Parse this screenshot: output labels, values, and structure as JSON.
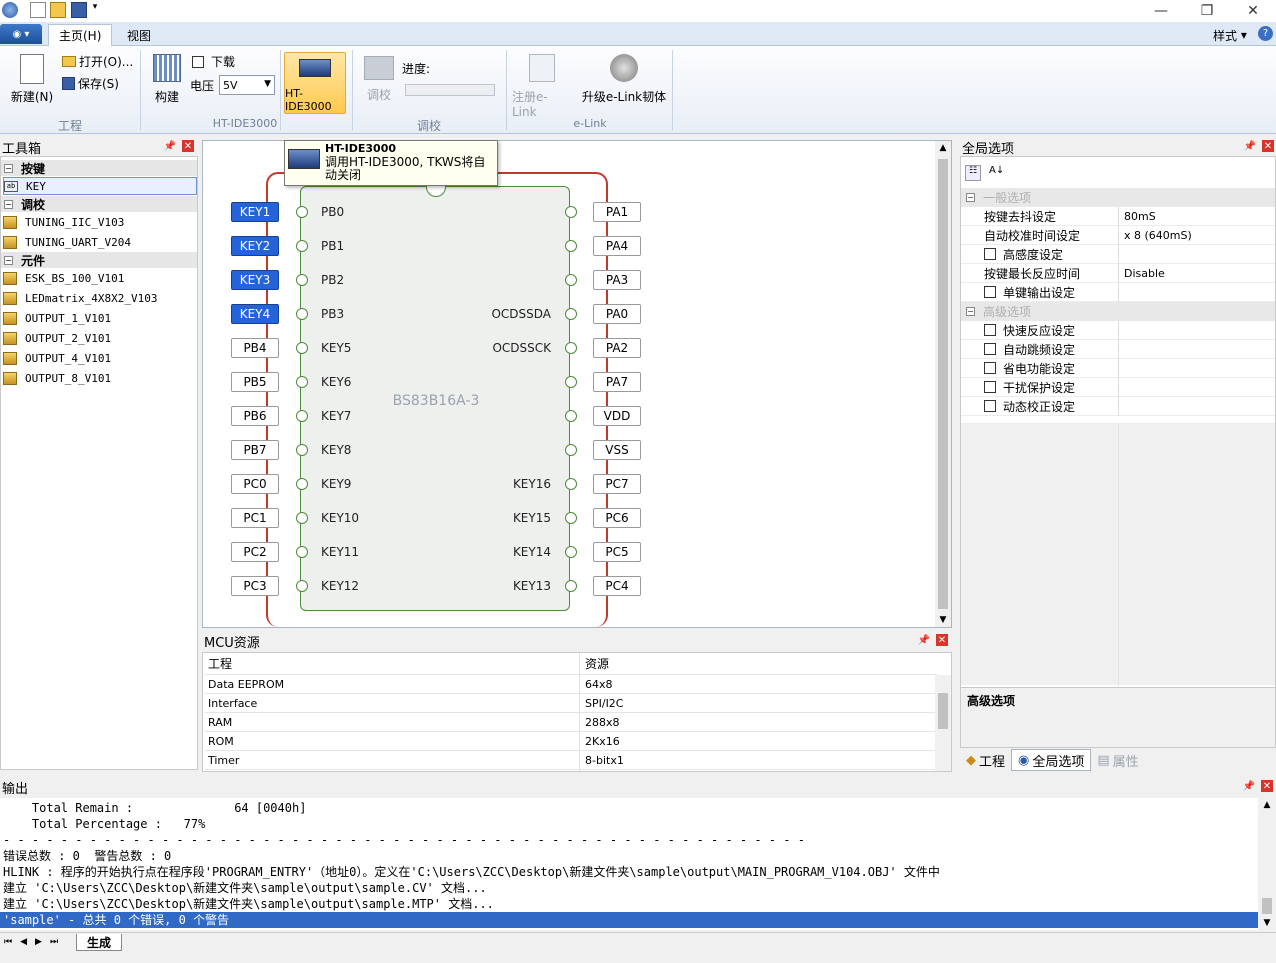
{
  "ribbon_tabs": {
    "main": "主页(H)",
    "view": "视图",
    "style": "样式"
  },
  "ribbon": {
    "new": "新建(N)",
    "open": "打开(O)...",
    "save": "保存(S)",
    "group_project": "工程",
    "build": "构建",
    "download": "下载",
    "voltage_label": "电压",
    "voltage_value": "5V",
    "ide_button": "HT-IDE3000",
    "group_ide": "HT-IDE3000",
    "calibrate": "调校",
    "progress_label": "进度:",
    "progress_value": 0,
    "group_calibrate": "调校",
    "register_elink": "注册e-Link",
    "upgrade_elink": "升级e-Link韧体",
    "group_elink": "e-Link"
  },
  "tooltip": {
    "title": "HT-IDE3000",
    "text": "调用HT-IDE3000, TKWS将自动关闭"
  },
  "toolbox": {
    "title": "工具箱",
    "categories": [
      {
        "label": "按键",
        "items": [
          "KEY"
        ]
      },
      {
        "label": "调校",
        "items": [
          "TUNING_IIC_V103",
          "TUNING_UART_V204"
        ]
      },
      {
        "label": "元件",
        "items": [
          "ESK_BS_100_V101",
          "LEDmatrix_4X8X2_V103",
          "OUTPUT_1_V101",
          "OUTPUT_2_V101",
          "OUTPUT_4_V101",
          "OUTPUT_8_V101"
        ]
      }
    ]
  },
  "designer": {
    "chip_name": "BS83B16A-3",
    "left_labels": [
      "KEY1",
      "KEY2",
      "KEY3",
      "KEY4",
      "PB4",
      "PB5",
      "PB6",
      "PB7",
      "PC0",
      "PC1",
      "PC2",
      "PC3"
    ],
    "left_pins": [
      "PB0",
      "PB1",
      "PB2",
      "PB3",
      "KEY5",
      "KEY6",
      "KEY7",
      "KEY8",
      "KEY9",
      "KEY10",
      "KEY11",
      "KEY12"
    ],
    "right_pins": [
      "",
      "",
      "",
      "OCDSSDA",
      "OCDSSCK",
      "",
      "",
      "",
      "KEY16",
      "KEY15",
      "KEY14",
      "KEY13"
    ],
    "right_labels": [
      "PA1",
      "PA4",
      "PA3",
      "PA0",
      "PA2",
      "PA7",
      "VDD",
      "VSS",
      "PC7",
      "PC6",
      "PC5",
      "PC4"
    ]
  },
  "mcu": {
    "title": "MCU资源",
    "col1": "工程",
    "col2": "资源",
    "rows": [
      [
        "Data EEPROM",
        "64x8"
      ],
      [
        "Interface",
        "SPI/I2C"
      ],
      [
        "RAM",
        "288x8"
      ],
      [
        "ROM",
        "2Kx16"
      ],
      [
        "Timer",
        "8-bitx1"
      ]
    ]
  },
  "global": {
    "title": "全局选项",
    "cat_general": "一般选项",
    "rows": [
      {
        "name": "按键去抖设定",
        "value": "80mS",
        "check": false
      },
      {
        "name": "自动校准时间设定",
        "value": "x 8 (640mS)",
        "check": false
      },
      {
        "name": "高感度设定",
        "value": "",
        "check": true
      },
      {
        "name": "按键最长反应时间",
        "value": "Disable",
        "check": false
      },
      {
        "name": "单键输出设定",
        "value": "",
        "check": true
      }
    ],
    "cat_advanced": "高级选项",
    "adv_rows": [
      "快速反应设定",
      "自动跳频设定",
      "省电功能设定",
      "干扰保护设定",
      "动态校正设定"
    ],
    "desc_title": "高级选项",
    "bottom_tabs": [
      "工程",
      "全局选项",
      "属性"
    ]
  },
  "output": {
    "title": "输出",
    "lines": [
      "    Total Remain :              64 [0040h]",
      "    Total Percentage :   77%",
      "- - - - - - - - - - - - - - - - - - - - - - - - - - - - - - - - - - - - - - - - - - - - - - - - - - - - - - - -",
      "错误总数 : 0  警告总数 : 0",
      "HLINK : 程序的开始执行点在程序段'PROGRAM_ENTRY'（地址0）。定义在'C:\\Users\\ZCC\\Desktop\\新建文件夹\\sample\\output\\MAIN_PROGRAM_V104.OBJ' 文件中",
      "建立 'C:\\Users\\ZCC\\Desktop\\新建文件夹\\sample\\output\\sample.CV' 文档...",
      "建立 'C:\\Users\\ZCC\\Desktop\\新建文件夹\\sample\\output\\sample.MTP' 文档..."
    ],
    "highlight": "'sample' - 总共 0 个错误, 0 个警告",
    "tab": "生成"
  },
  "colors": {
    "accent": "#2563d9",
    "selection": "#3169c6",
    "chip_outline": "#c0392b",
    "chip_inner": "#4d8a3c"
  }
}
